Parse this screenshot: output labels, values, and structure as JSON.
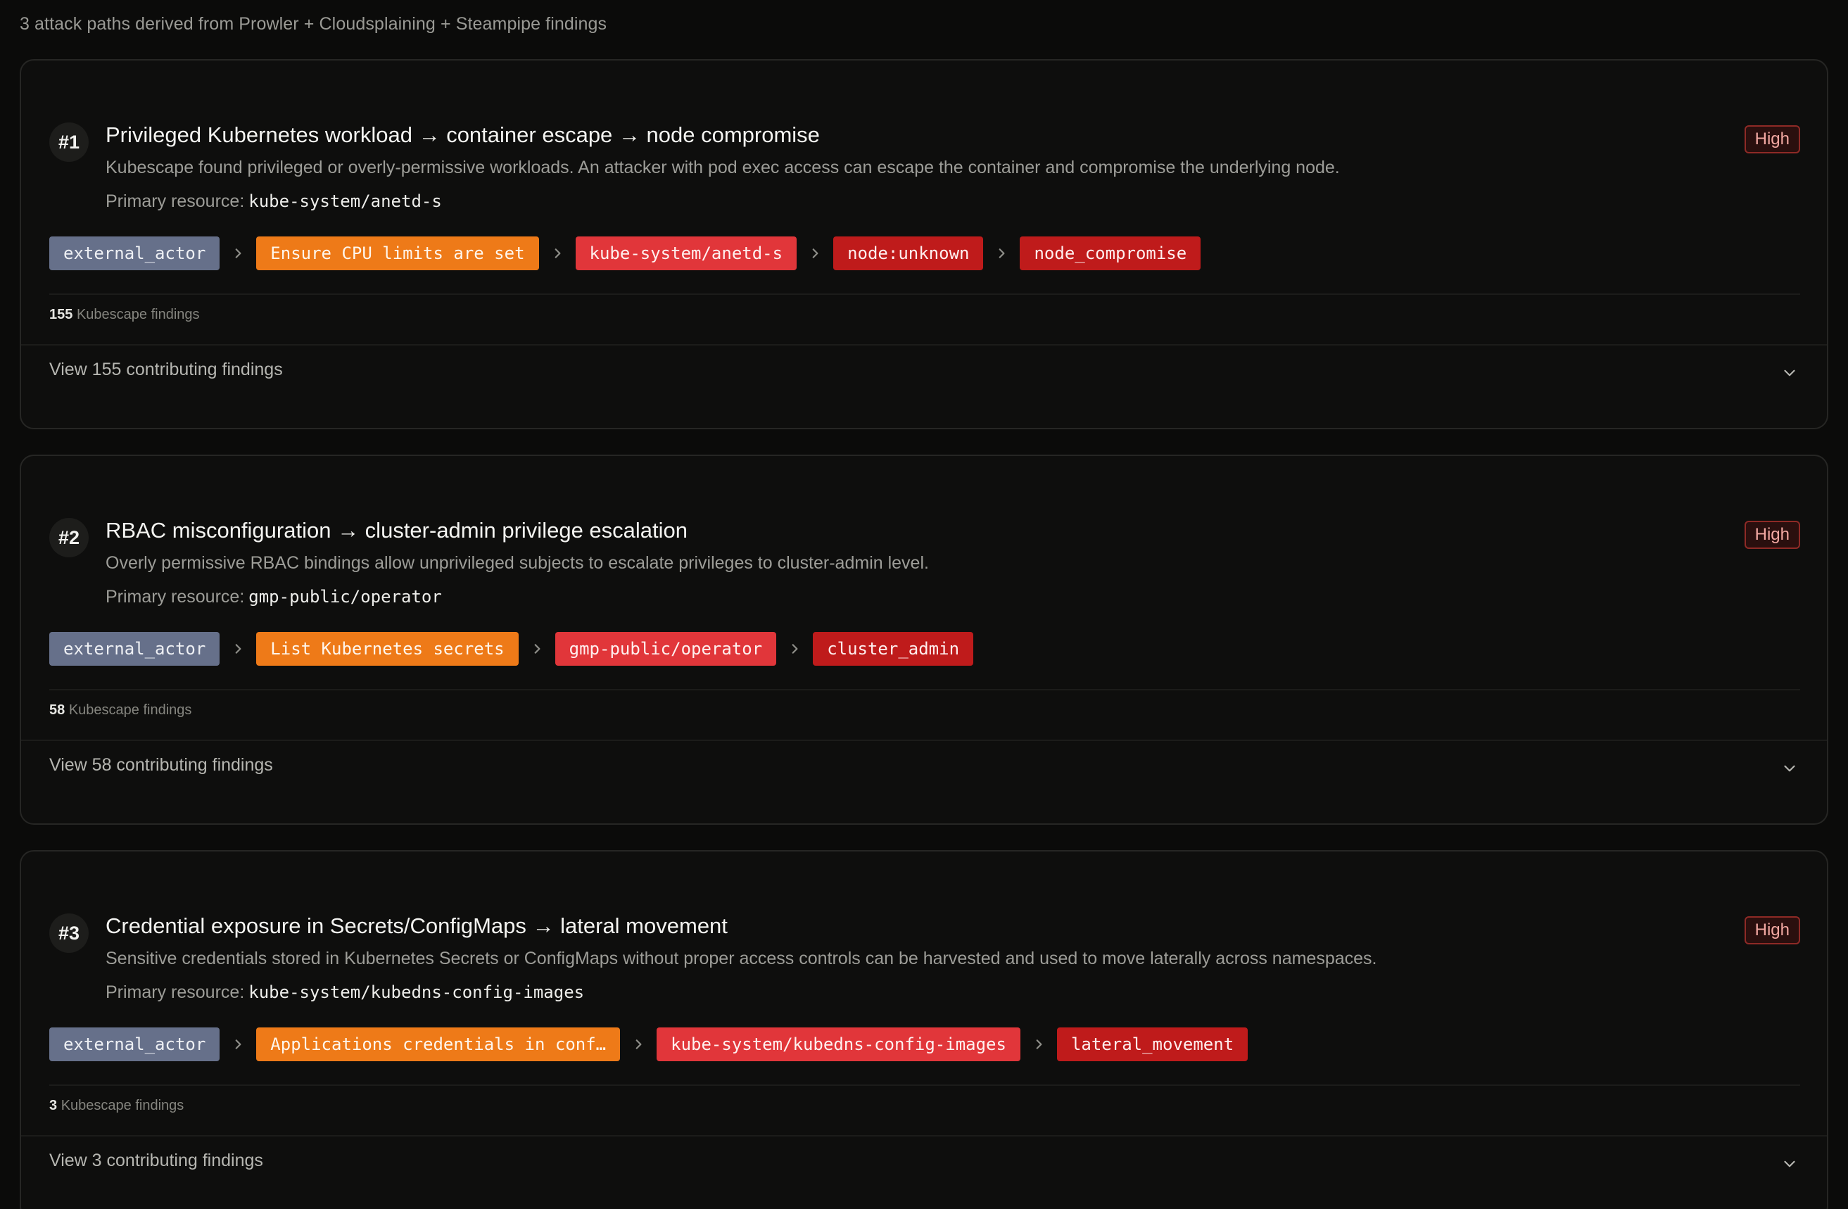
{
  "summary": "3 attack paths derived from Prowler + Cloudsplaining + Steampipe findings",
  "colors": {
    "actor": "#66708a",
    "technique": "#ee7a18",
    "resource": "#e1363a",
    "impact": "#bf1b1b",
    "badge_high": "#8e2a26"
  },
  "paths": [
    {
      "rank": "#1",
      "title": "Privileged Kubernetes workload → container escape → node compromise",
      "description": "Kubescape found privileged or overly-permissive workloads. An attacker with pod exec access can escape the container and compromise the underlying node.",
      "primary_label": "Primary resource:",
      "primary_resource": "kube-system/anetd-s",
      "severity": "High",
      "chain": [
        {
          "label": "external_actor",
          "kind": "actor"
        },
        {
          "label": "Ensure CPU limits are set",
          "kind": "technique"
        },
        {
          "label": "kube-system/anetd-s",
          "kind": "resource"
        },
        {
          "label": "node:unknown",
          "kind": "impact"
        },
        {
          "label": "node_compromise",
          "kind": "impact"
        }
      ],
      "findings_count": "155",
      "findings_source": "Kubescape findings",
      "expand_label": "View 155 contributing findings"
    },
    {
      "rank": "#2",
      "title": "RBAC misconfiguration → cluster-admin privilege escalation",
      "description": "Overly permissive RBAC bindings allow unprivileged subjects to escalate privileges to cluster-admin level.",
      "primary_label": "Primary resource:",
      "primary_resource": "gmp-public/operator",
      "severity": "High",
      "chain": [
        {
          "label": "external_actor",
          "kind": "actor"
        },
        {
          "label": "List Kubernetes secrets",
          "kind": "technique"
        },
        {
          "label": "gmp-public/operator",
          "kind": "resource"
        },
        {
          "label": "cluster_admin",
          "kind": "impact"
        }
      ],
      "findings_count": "58",
      "findings_source": "Kubescape findings",
      "expand_label": "View 58 contributing findings"
    },
    {
      "rank": "#3",
      "title": "Credential exposure in Secrets/ConfigMaps → lateral movement",
      "description": "Sensitive credentials stored in Kubernetes Secrets or ConfigMaps without proper access controls can be harvested and used to move laterally across namespaces.",
      "primary_label": "Primary resource:",
      "primary_resource": "kube-system/kubedns-config-images",
      "severity": "High",
      "chain": [
        {
          "label": "external_actor",
          "kind": "actor"
        },
        {
          "label": "Applications credentials in conf…",
          "kind": "technique"
        },
        {
          "label": "kube-system/kubedns-config-images",
          "kind": "resource"
        },
        {
          "label": "lateral_movement",
          "kind": "impact"
        }
      ],
      "findings_count": "3",
      "findings_source": "Kubescape findings",
      "expand_label": "View 3 contributing findings"
    }
  ]
}
